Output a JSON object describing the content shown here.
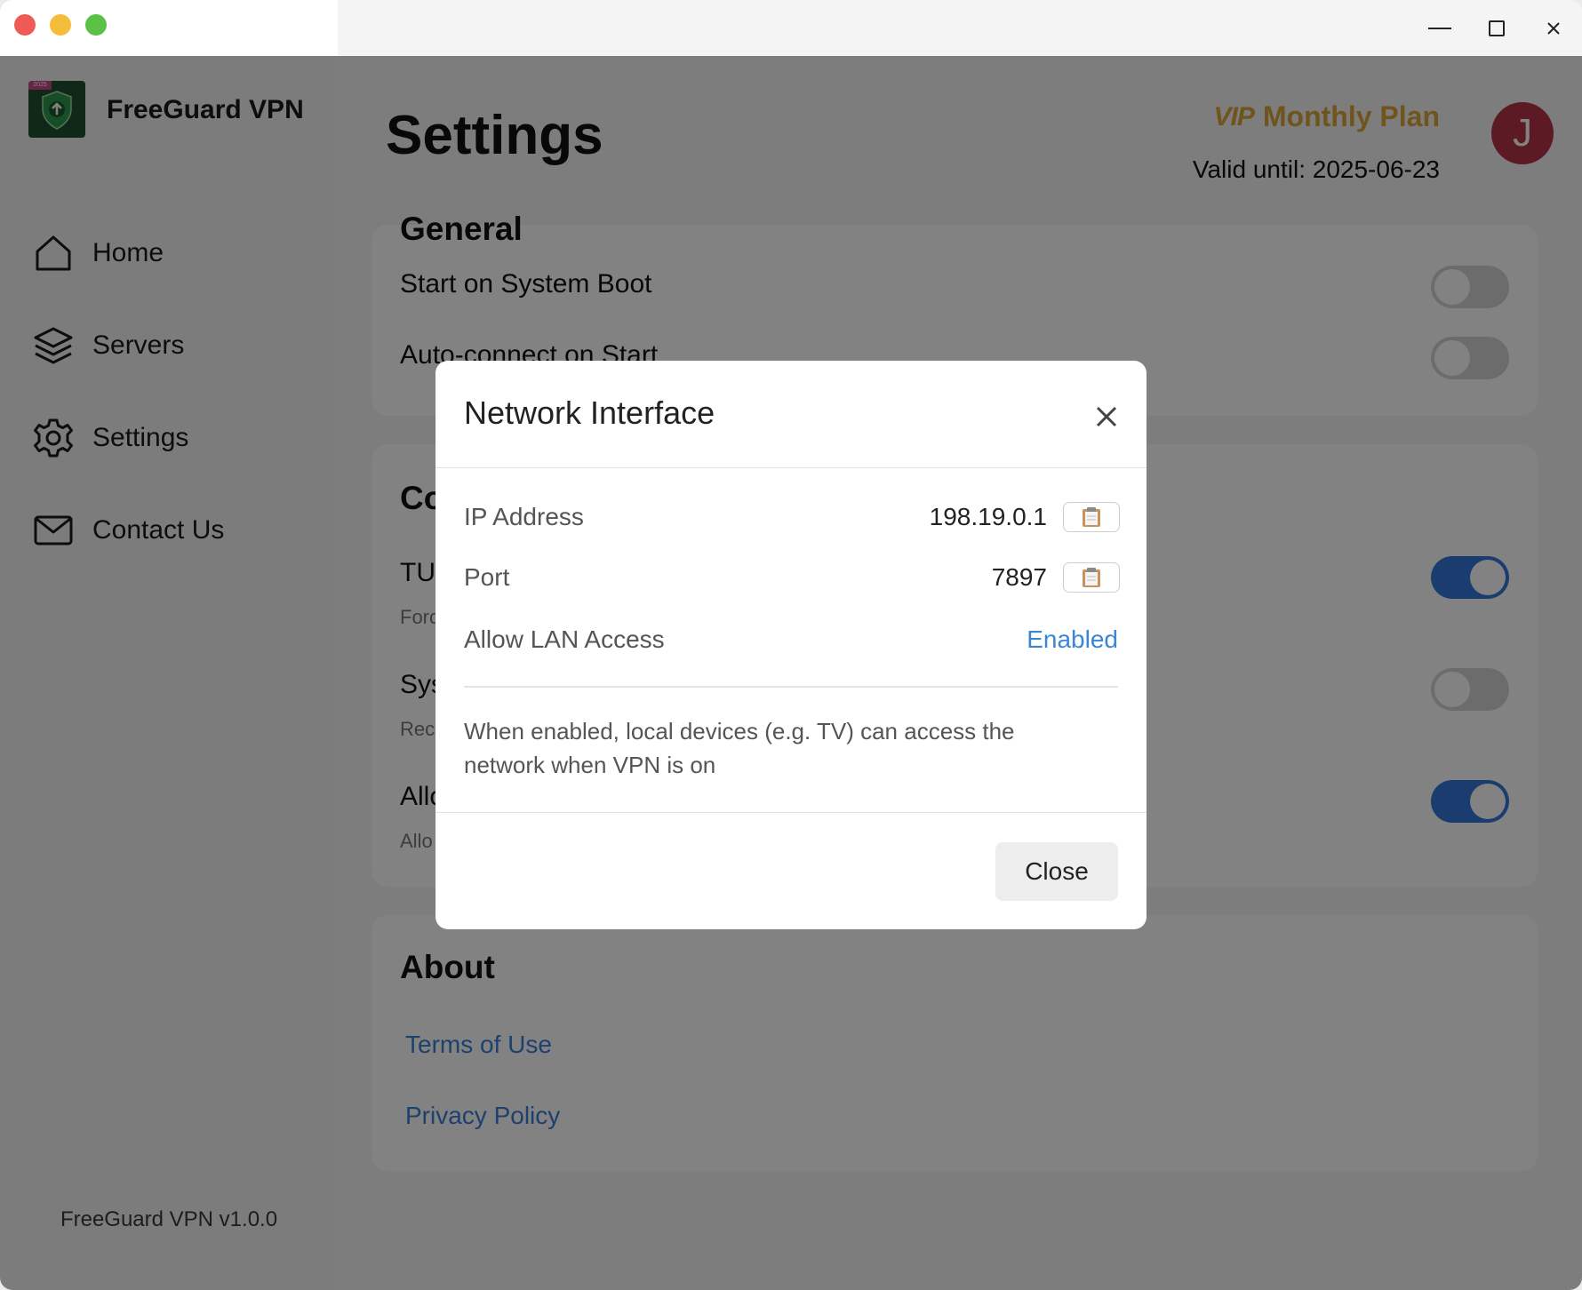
{
  "app": {
    "name": "FreeGuard VPN",
    "version": "FreeGuard VPN v1.0.0",
    "logo_badge": "2025"
  },
  "window_controls": [
    "minimize-icon",
    "maximize-icon",
    "close-icon"
  ],
  "nav": {
    "home": "Home",
    "servers": "Servers",
    "settings": "Settings",
    "contact": "Contact Us"
  },
  "header": {
    "title": "Settings",
    "vip_badge": "VIP",
    "plan": "Monthly Plan",
    "valid_until": "Valid until: 2025-06-23",
    "avatar_initial": "J"
  },
  "general": {
    "title": "General",
    "start_on_boot": "Start on System Boot",
    "auto_connect": "Auto-connect on Start",
    "start_on_boot_enabled": false,
    "auto_connect_enabled": false
  },
  "connection": {
    "title": "Co",
    "tun_label": "TU",
    "tun_desc": "Forc",
    "tun_enabled": true,
    "sys_label": "Sys",
    "sys_desc": "Rec",
    "sys_enabled": false,
    "allow_label": "Allo",
    "allow_desc": "Allo",
    "allow_enabled": true
  },
  "about": {
    "title": "About",
    "terms": "Terms of Use",
    "privacy": "Privacy Policy"
  },
  "modal": {
    "title": "Network Interface",
    "ip_label": "IP Address",
    "ip_value": "198.19.0.1",
    "port_label": "Port",
    "port_value": "7897",
    "lan_label": "Allow LAN Access",
    "lan_value": "Enabled",
    "description": "When enabled, local devices (e.g. TV) can access the network when VPN is on",
    "close_button": "Close"
  },
  "colors": {
    "accent": "#3b7ed6",
    "vip_gold": "#d9a53a",
    "avatar": "#b5334a",
    "toggle_on": "#3577d8"
  }
}
